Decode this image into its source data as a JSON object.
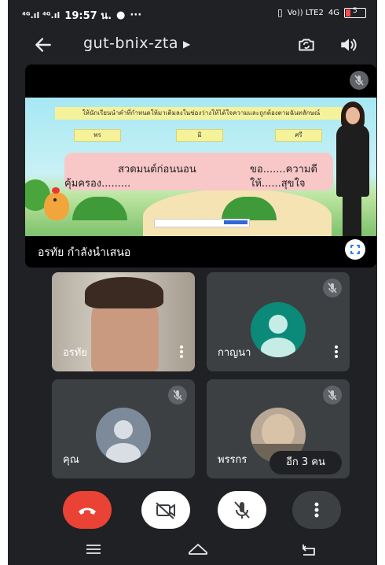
{
  "status_bar": {
    "signal": "⁴ᴳ.ıl ⁴ᴳ.ıl",
    "time": "19:57 น.",
    "volte": "Vo)) LTE2",
    "net": "4G",
    "battery": "5"
  },
  "header": {
    "meeting_code": "gut-bnix-zta",
    "back_icon": "arrow-left-icon",
    "switch_camera_icon": "switch-camera-icon",
    "speaker_icon": "speaker-icon"
  },
  "presentation": {
    "presenter_label": "อรทัย กำลังนำเสนอ",
    "slide": {
      "instruction": "ให้นักเรียนนำคำที่กำหนดให้มาเติมลงในช่องว่างให้ได้ใจความและถูกต้องตามฉันทลักษณ์",
      "words": [
        "พร",
        "มิ",
        "ศรี"
      ],
      "line1_left": "สวดมนต์ก่อนนอน",
      "line1_right": "ขอ.......ความดี",
      "line2_left": "คุ้มครอง.........",
      "line2_right": "ให้......สุขใจ"
    }
  },
  "participants": [
    {
      "name": "อรทัย",
      "type": "video"
    },
    {
      "name": "กาญนา",
      "type": "avatar",
      "avatar_color": "#0b8a7a"
    },
    {
      "name": "คุณ",
      "type": "avatar",
      "avatar_color": "#7d8a99"
    },
    {
      "name": "พรรกร",
      "type": "photo"
    }
  ],
  "more_participants": "อีก 3 คน",
  "controls": {
    "end_call_color": "#ea4335",
    "end_call_icon": "end-call-icon",
    "camera_icon": "camera-off-icon",
    "mic_icon": "mic-off-icon",
    "more_icon": "more-vert-icon"
  },
  "navigation": {
    "recents_icon": "recents-icon",
    "home_icon": "home-icon",
    "back_icon": "nav-back-icon"
  }
}
